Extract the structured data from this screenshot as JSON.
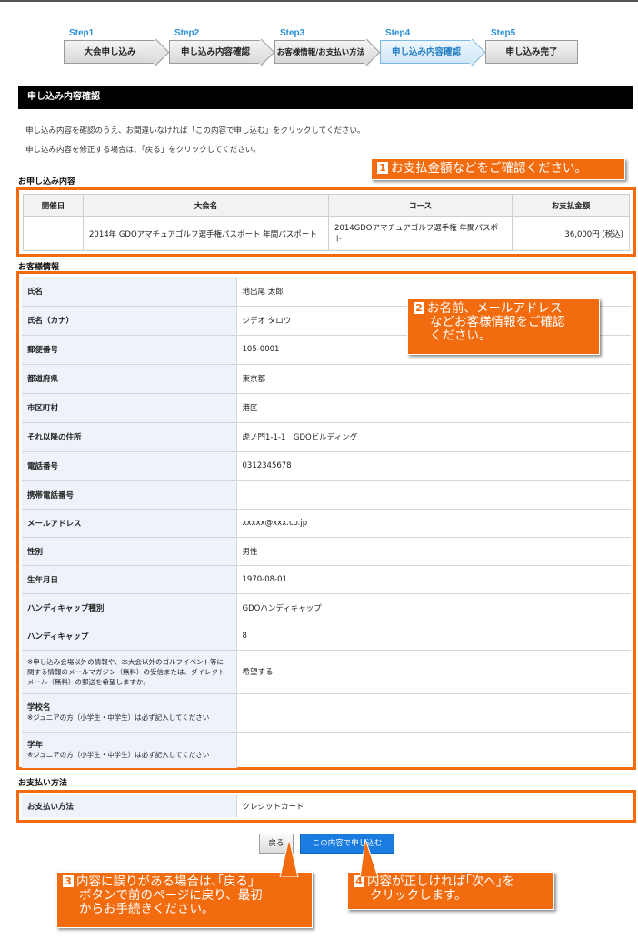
{
  "steps": [
    {
      "label": "Step1",
      "title": "大会申し込み"
    },
    {
      "label": "Step2",
      "title": "申し込み内容確認"
    },
    {
      "label": "Step3",
      "title": "お客様情報/お支払い方法"
    },
    {
      "label": "Step4",
      "title": "申し込み内容確認"
    },
    {
      "label": "Step5",
      "title": "申し込み完了"
    }
  ],
  "page_title": "申し込み内容確認",
  "intro": [
    "申し込み内容を確認のうえ、お間違いなければ「この内容で申し込む」をクリックしてください。",
    "申し込み内容を修正する場合は、「戻る」をクリックしてください。"
  ],
  "order": {
    "section_title": "お申し込み内容",
    "headers": [
      "開催日",
      "大会名",
      "コース",
      "お支払金額"
    ],
    "row": [
      "",
      "2014年 GDOアマチュアゴルフ選手権パスポート 年間パスポート",
      "2014GDOアマチュアゴルフ選手権 年間パスポート",
      "36,000円 (税込)"
    ]
  },
  "customer": {
    "section_title": "お客様情報",
    "rows": [
      {
        "key": "氏名",
        "value": "地出尾 太郎"
      },
      {
        "key": "氏名（カナ）",
        "value": "ジデオ タロウ"
      },
      {
        "key": "郵便番号",
        "value": "105-0001"
      },
      {
        "key": "都道府県",
        "value": "東京都"
      },
      {
        "key": "市区町村",
        "value": "港区"
      },
      {
        "key": "それ以降の住所",
        "value": "虎ノ門1-1-1　GDOビルディング"
      },
      {
        "key": "電話番号",
        "value": "0312345678"
      },
      {
        "key": "携帯電話番号",
        "value": ""
      },
      {
        "key": "メールアドレス",
        "value": "xxxxx@xxx.co.jp"
      },
      {
        "key": "性別",
        "value": "男性"
      },
      {
        "key": "生年月日",
        "value": "1970-08-01"
      },
      {
        "key": "ハンディキャップ種別",
        "value": "GDOハンディキャップ"
      },
      {
        "key": "ハンディキャップ",
        "value": "8"
      }
    ],
    "newsletter_key": "※申し込み会場以外の情報や、本大会以外のゴルフイベント等に関する情報のメールマガジン（無料）の受信または、ダイレクトメール（無料）の郵送を希望しますか。",
    "newsletter_value": "希望する",
    "school_key": "学校名",
    "school_note": "※ジュニアの方（小学生・中学生）は必ず記入してください",
    "grade_key": "学年",
    "grade_note": "※ジュニアの方（小学生・中学生）は必ず記入してください"
  },
  "payment": {
    "section_title": "お支払い方法",
    "key": "お支払い方法",
    "value": "クレジットカード"
  },
  "buttons": {
    "back": "戻る",
    "submit": "この内容で申し込む"
  },
  "callouts": {
    "c1_num": "1",
    "c1": "お支払金額などをご確認ください。",
    "c2_num": "2",
    "c2_l1": "お名前、メールアドレス",
    "c2_l2": "などお客様情報をご確認",
    "c2_l3": "ください。",
    "c3_num": "3",
    "c3_l1": "内容に誤りがある場合は､｢戻る｣",
    "c3_l2": "ボタンで前のページに戻り、最初",
    "c3_l3": "からお手続きください。",
    "c4_num": "4",
    "c4_l1": "内容が正しければ｢次へ｣を",
    "c4_l2": "クリックします。"
  },
  "colors": {
    "accent": "#f26b0f",
    "step_active": "#1d7ac2",
    "button_primary": "#1a7be0"
  }
}
